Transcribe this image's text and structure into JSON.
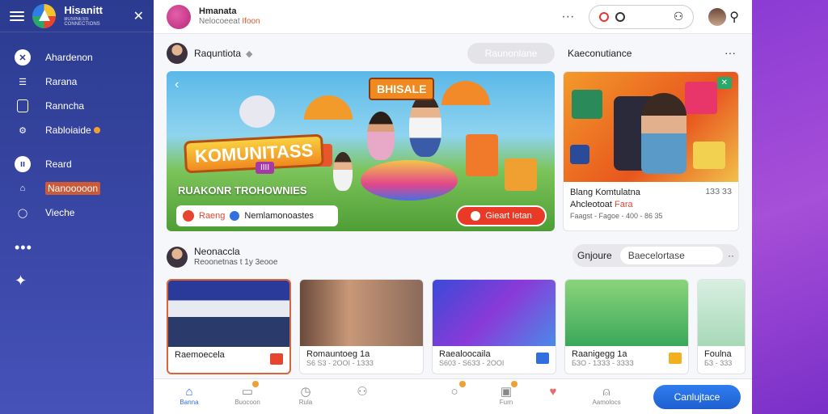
{
  "app": {
    "brand_name": "Hisanitt",
    "brand_sub": "BUSINESS CONNECTIONS"
  },
  "sidebar": {
    "items": [
      {
        "label": "Ahardenon"
      },
      {
        "label": "Rarana"
      },
      {
        "label": "Ranncha"
      },
      {
        "label": "Rabloiaide"
      },
      {
        "label": "Reard"
      },
      {
        "label": "Nanooooon"
      },
      {
        "label": "Vieche"
      }
    ],
    "more": "•••"
  },
  "topbar": {
    "name": "Hmanata",
    "sub_a": "Nelocoeeat",
    "sub_b": "Ifoon"
  },
  "feed": {
    "header_title": "Raquntiota",
    "header_button": "Raunonlane",
    "side_title": "Kaeconutiance"
  },
  "hero": {
    "sign": "BHISALE",
    "title": "KOMUNITASS",
    "tag": "IIII",
    "subtitle": "RUAKONR TROHOWNIES",
    "left_badge": "Raeng",
    "left_text": "Nemlamonoastes",
    "cta": "Gieart Ietan"
  },
  "promo": {
    "line1": "Blang Komtulatna",
    "line1_right": "1ЗЗ ЗЗ",
    "line2": "Ahcleotoat",
    "line2_red": "Fara",
    "line3": "Faagst - Fagoe - 400 - 86 35"
  },
  "section2": {
    "title": "Neonaccla",
    "sub": "Reoonetnas t 1y 3eooe",
    "group_label": "Gnjoure",
    "group_value": "Baecelortase",
    "cards": [
      {
        "label": "Raemoecela",
        "meta": ""
      },
      {
        "label": "Romauntoeg 1a",
        "meta": "S6 S3 - 2ООI - 1ЗЗ3"
      },
      {
        "label": "Raealoocaila",
        "meta": "S603 - S6ЗЗ - 2ООI"
      },
      {
        "label": "Raanigegg 1a",
        "meta": "БЗО - 1ЗЗЗ - 3ЗЗЗ"
      },
      {
        "label": "Foulna",
        "meta": "БЗ - 333"
      }
    ]
  },
  "bottom_nav": {
    "items": [
      {
        "label": "Banna"
      },
      {
        "label": "Buocoon"
      },
      {
        "label": "Rula"
      },
      {
        "label": ""
      },
      {
        "label": ""
      },
      {
        "label": "Furn"
      },
      {
        "label": ""
      },
      {
        "label": "Aamolocs"
      }
    ],
    "cta": "Canlujtace"
  },
  "colors": {
    "sidebar": "#2b3b8f",
    "accent": "#2f6fe0",
    "cta_red": "#e83a26",
    "strip": "#a64fd8"
  }
}
